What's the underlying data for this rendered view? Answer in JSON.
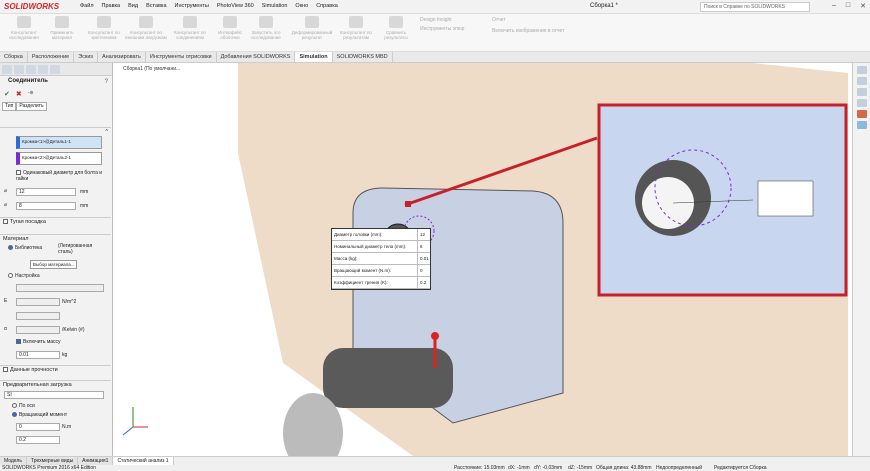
{
  "app": {
    "logo": "SOLIDWORKS",
    "doc_title": "Сборка1 *",
    "help_search_placeholder": "Поиск в Справке по SOLIDWORKS"
  },
  "menu": [
    "Файл",
    "Правка",
    "Вид",
    "Вставка",
    "Инструменты",
    "PhotoView 360",
    "Simulation",
    "Окно",
    "Справка"
  ],
  "ribbon": [
    "Консультант исследования",
    "Применить материал",
    "Консультант по креплениям",
    "Консультант по внешним нагрузкам",
    "Консультант по соединениям",
    "Интерфейс оболочки",
    "Запустить это исследование",
    "Деформированный результат",
    "Консультант по результатам",
    "Сравнить результаты",
    "Инструменты эпюр",
    "Design Insight",
    "Отчет",
    "Включить изображение в отчет"
  ],
  "tabs": [
    "Сборка",
    "Расположение",
    "Эскиз",
    "Анализировать",
    "Инструменты отрисовки",
    "Добавления SOLIDWORKS",
    "Simulation",
    "SOLIDWORKS MBD"
  ],
  "active_tab": "Simulation",
  "panel": {
    "title": "Соединитель",
    "help": "?",
    "ok": "✔",
    "cancel": "✖",
    "pin": "-⊕",
    "subtabs": [
      "Тип",
      "Разделить"
    ],
    "sel1": "Кромка<1>@Деталь1-1",
    "sel2": "Кромка<2>@Деталь2-1",
    "same_diameter": "Одинаковый диаметр для болта и гайки",
    "diameter": "12",
    "diameter_unit": "mm",
    "diameter2": "8",
    "diameter2_unit": "mm",
    "snug_fit": "Тугая посадка",
    "material_section": "Материал",
    "library": "Библиотека",
    "library_value": "(Легированная сталь)",
    "select_material": "Выбор материала...",
    "custom": "Настройка",
    "modulus_unit": "N/m^2",
    "thermal_unit": "/Kelvin (#)",
    "include_mass": "Включить массу",
    "mass": "0.01",
    "mass_unit": "kg",
    "strength_data": "Данные прочности",
    "preload_section": "Предварительная загрузка",
    "units": "SI",
    "axial": "По оси",
    "torque": "Вращающий момент",
    "torque_value": "0",
    "torque_unit": "N.m",
    "friction": "0.2"
  },
  "viewport": {
    "breadcrumb": "Сборка1 (По умолчани..."
  },
  "infobox": [
    {
      "k": "Диаметр головки (mm):",
      "v": "12"
    },
    {
      "k": "Номинальный диаметр тела (mm):",
      "v": "8"
    },
    {
      "k": "Масса (kg):",
      "v": "0.01"
    },
    {
      "k": "Вращающий момент (N.m):",
      "v": "0"
    },
    {
      "k": "Коэффициент трения (K):",
      "v": "0.2"
    }
  ],
  "bottom_tabs": [
    "Модель",
    "Трехмерные виды",
    "Анимация1",
    "Статический анализ 1"
  ],
  "status": {
    "edition": "SOLIDWORKS Premium 2016 x64 Edition",
    "distance": "Расстояние: 15.03mm",
    "dx": "dX: -1mm",
    "dy": "dY: -0.03mm",
    "dz": "dZ: -15mm",
    "total": "Общая длина: 43.88mm",
    "state": "Недоопределенный",
    "editing": "Редактируется Сборка"
  },
  "colors": {
    "accent_red": "#d8232a",
    "callout_red": "#c8202a",
    "selection_blue": "#2f6bd8",
    "selection_purple": "#7a2bd8",
    "bracket": "#c8d0e4",
    "bg_beige": "#eedcc9"
  }
}
